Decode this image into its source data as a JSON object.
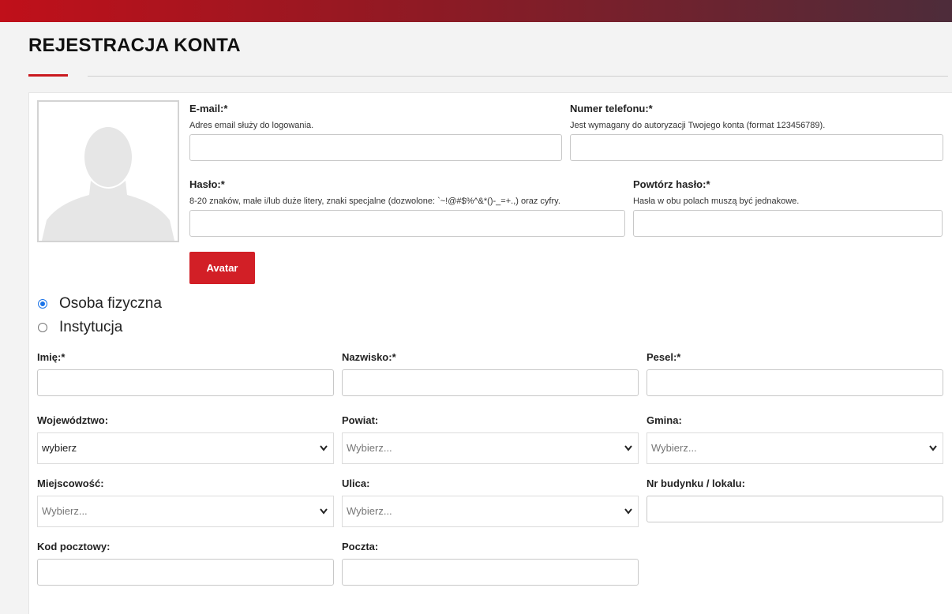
{
  "page": {
    "title": "REJESTRACJA KONTA"
  },
  "account": {
    "email_label": "E-mail:*",
    "email_hint": "Adres email służy do logowania.",
    "email_value": "",
    "phone_label": "Numer telefonu:*",
    "phone_hint": "Jest wymagany do autoryzacji Twojego konta (format 123456789).",
    "phone_value": "",
    "password_label": "Hasło:*",
    "password_hint": "8-20 znaków, małe i/lub duże litery, znaki specjalne (dozwolone: `~!@#$%^&*()-_=+.,) oraz cyfry.",
    "password_value": "",
    "password_repeat_label": "Powtórz hasło:*",
    "password_repeat_hint": "Hasła w obu polach muszą być jednakowe.",
    "password_repeat_value": "",
    "avatar_button": "Avatar"
  },
  "person_type": {
    "options": [
      "Osoba fizyczna",
      "Instytucja"
    ],
    "selected": "Osoba fizyczna"
  },
  "personal": {
    "first_name_label": "Imię:*",
    "last_name_label": "Nazwisko:*",
    "pesel_label": "Pesel:*"
  },
  "address": {
    "voivodeship_label": "Województwo:",
    "voivodeship_value": "wybierz",
    "county_label": "Powiat:",
    "county_value": "Wybierz...",
    "commune_label": "Gmina:",
    "commune_value": "Wybierz...",
    "city_label": "Miejscowość:",
    "city_value": "Wybierz...",
    "street_label": "Ulica:",
    "street_value": "Wybierz...",
    "building_label": "Nr budynku / lokalu:",
    "postal_code_label": "Kod pocztowy:",
    "post_office_label": "Poczta:"
  },
  "icons": {
    "avatar_placeholder": "user-silhouette-icon",
    "select_arrow": "chevron-down-icon"
  },
  "colors": {
    "accent": "#d21f26",
    "radio_selected": "#1a73e8"
  }
}
